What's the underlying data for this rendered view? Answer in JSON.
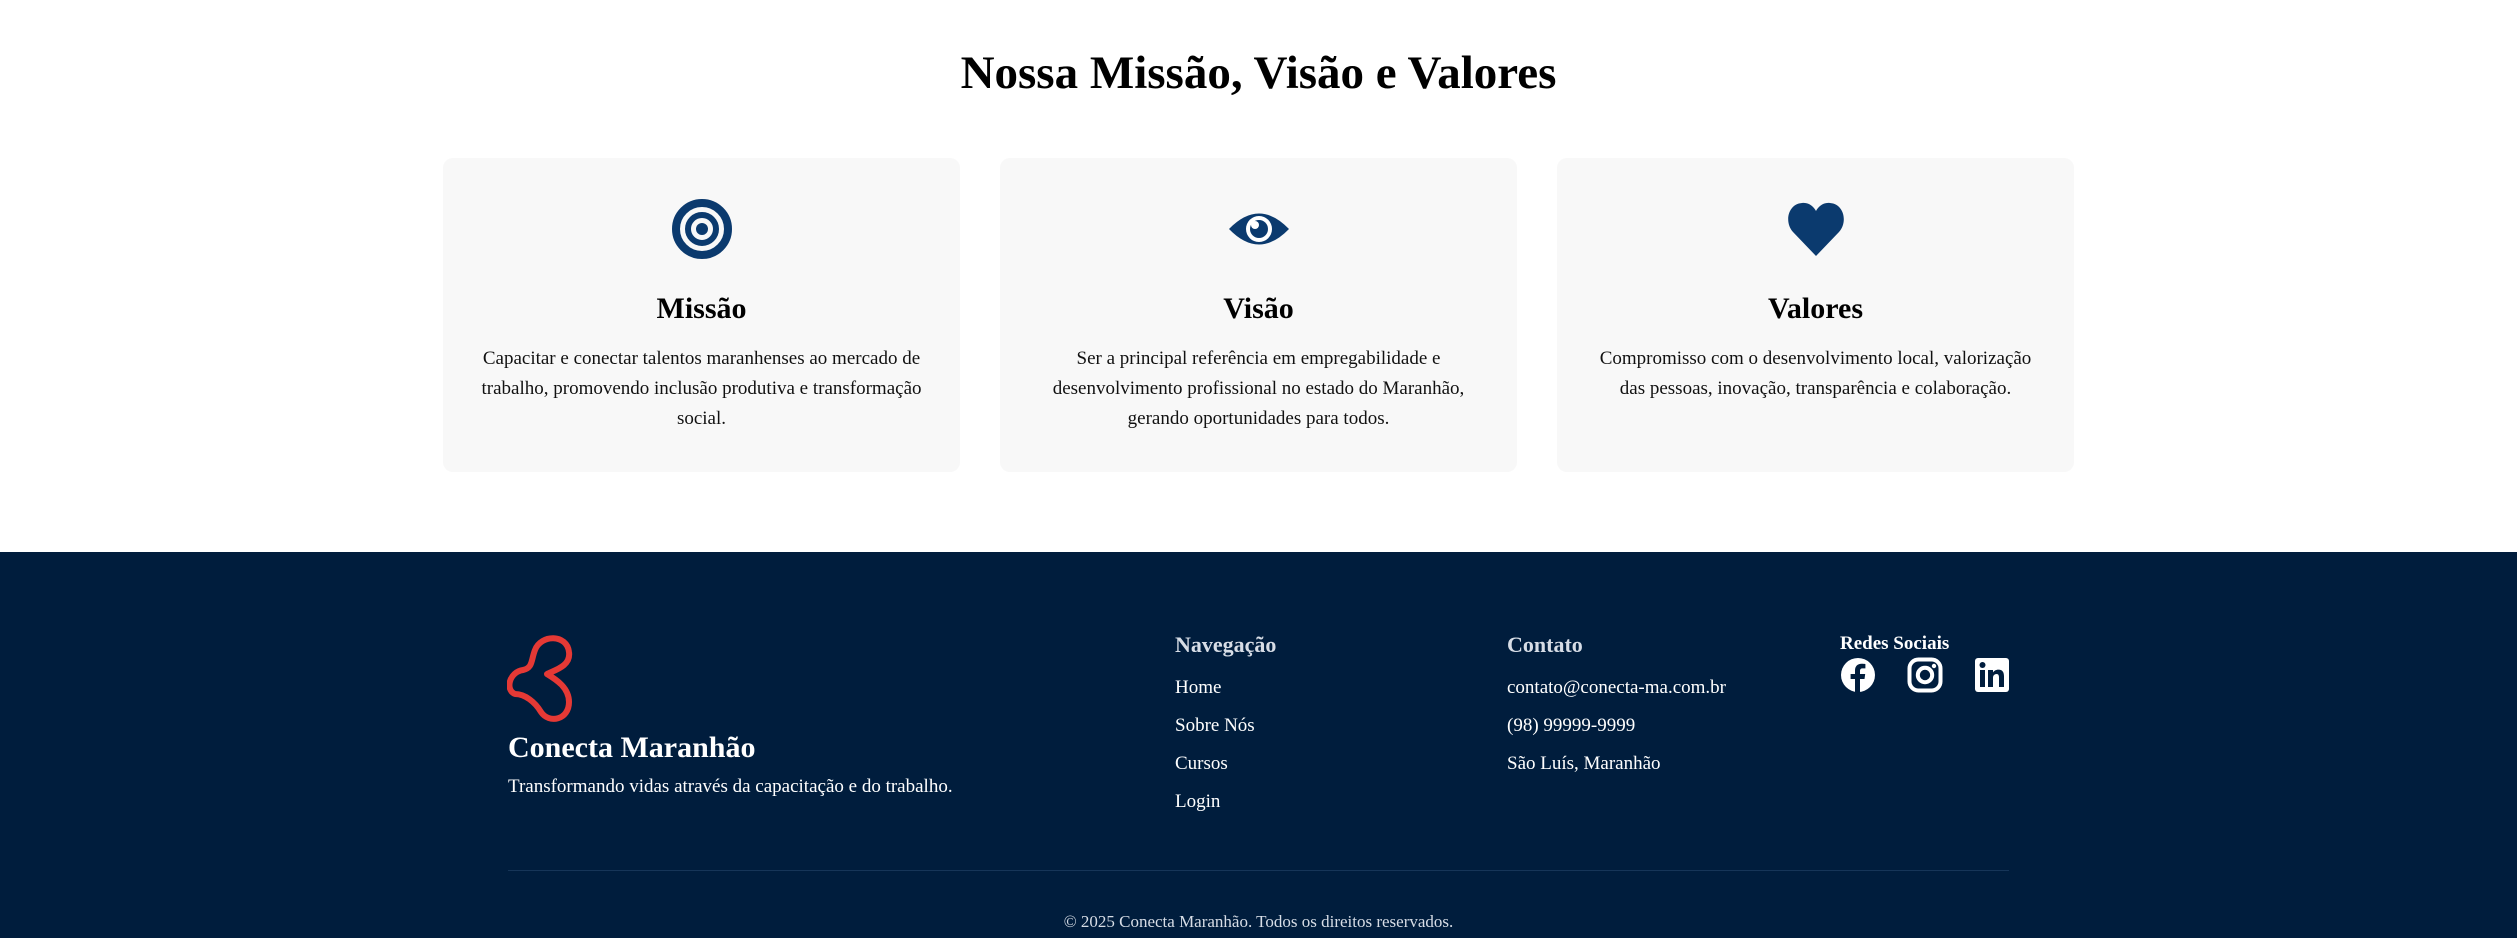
{
  "mvv": {
    "title": "Nossa Missão, Visão e Valores",
    "cards": [
      {
        "icon": "target-icon",
        "title": "Missão",
        "text": "Capacitar e conectar talentos maranhenses ao mercado de trabalho, promovendo inclusão produtiva e transformação social."
      },
      {
        "icon": "eye-icon",
        "title": "Visão",
        "text": "Ser a principal referência em empregabilidade e desenvolvimento profissional no estado do Maranhão, gerando oportunidades para todos."
      },
      {
        "icon": "heart-icon",
        "title": "Valores",
        "text": "Compromisso com o desenvolvimento local, valorização das pessoas, inovação, transparência e colaboração."
      }
    ],
    "icon_color": "#0b3a6e"
  },
  "footer": {
    "background": "#001d3d",
    "brand": {
      "logo_icon": "conecta-logo-icon",
      "logo_color": "#e53935",
      "name": "Conecta Maranhão",
      "tagline": "Transformando vidas através da capacitação e do trabalho."
    },
    "navigation": {
      "heading": "Navegação",
      "links": [
        "Home",
        "Sobre Nós",
        "Cursos",
        "Login"
      ]
    },
    "contact": {
      "heading": "Contato",
      "items": [
        "contato@conecta-ma.com.br",
        "(98) 99999-9999",
        "São Luís, Maranhão"
      ]
    },
    "social": {
      "heading": "Redes Sociais",
      "icons": [
        "facebook-icon",
        "instagram-icon",
        "linkedin-icon"
      ]
    },
    "copyright": "© 2025 Conecta Maranhão. Todos os direitos reservados."
  }
}
